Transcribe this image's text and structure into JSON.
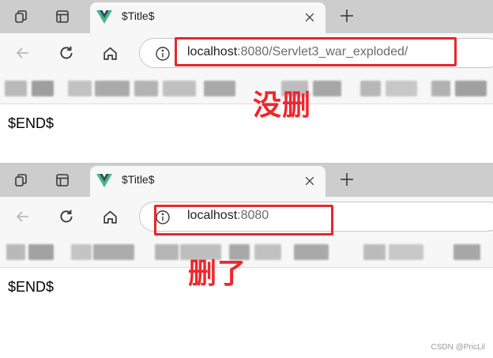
{
  "colors": {
    "tab_strip_bg": "#cdcdcd",
    "toolbar_bg": "#f7f7f7",
    "annotation_red": "#e8262d",
    "vue_green": "#41b883",
    "vue_dark": "#35495e"
  },
  "top": {
    "tab": {
      "title": "$Title$",
      "favicon": "vue-logo-icon"
    },
    "address": {
      "host": "localhost",
      "rest": ":8080/Servlet3_war_exploded/"
    },
    "page_text": "$END$",
    "annotation": "没删"
  },
  "bottom": {
    "tab": {
      "title": "$Title$",
      "favicon": "vue-logo-icon"
    },
    "address": {
      "host": "localhost",
      "rest": ":8080"
    },
    "page_text": "$END$",
    "annotation": "删了"
  },
  "icons": {
    "workspaces": "workspaces-icon",
    "tab_actions": "tab-actions-icon",
    "close": "close-icon",
    "new_tab": "plus-icon",
    "back": "back-arrow-icon",
    "refresh": "refresh-icon",
    "home": "home-icon",
    "site_info": "info-icon"
  },
  "watermark": "CSDN @PricLil"
}
